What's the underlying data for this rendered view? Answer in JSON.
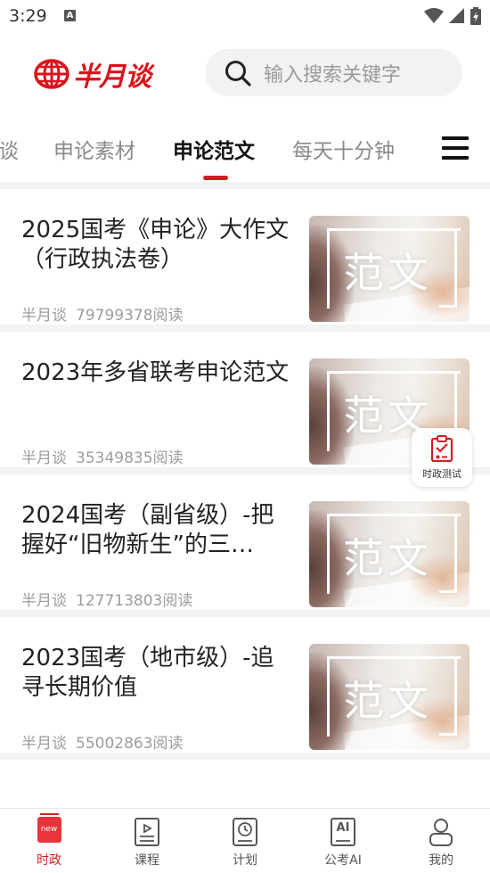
{
  "status_bar": {
    "time": "3:29",
    "notif_letter": "A"
  },
  "header": {
    "logo_text": "半月谈",
    "search_placeholder": "输入搜索关键字"
  },
  "tabs": [
    {
      "label": "谈",
      "active": false
    },
    {
      "label": "申论素材",
      "active": false
    },
    {
      "label": "申论范文",
      "active": true
    },
    {
      "label": "每天十分钟",
      "active": false
    }
  ],
  "articles": [
    {
      "title": "2025国考《申论》大作文（行政执法卷）",
      "source": "半月谈",
      "reads": "79799378阅读",
      "thumb_text": "范文"
    },
    {
      "title": "2023年多省联考申论范文",
      "source": "半月谈",
      "reads": "35349835阅读",
      "thumb_text": "范文"
    },
    {
      "title": "2024国考（副省级）-把握好“旧物新生”的三…",
      "source": "半月谈",
      "reads": "127713803阅读",
      "thumb_text": "范文"
    },
    {
      "title": "2023国考（地市级）-追寻长期价值",
      "source": "半月谈",
      "reads": "55002863阅读",
      "thumb_text": "范文"
    }
  ],
  "float_button": {
    "label": "时政测试"
  },
  "bottom_nav": [
    {
      "label": "时政",
      "icon": "news-icon",
      "badge": "new",
      "active": true
    },
    {
      "label": "课程",
      "icon": "course-icon",
      "active": false
    },
    {
      "label": "计划",
      "icon": "plan-icon",
      "active": false
    },
    {
      "label": "公考AI",
      "icon": "ai-icon",
      "icon_text": "AI",
      "active": false
    },
    {
      "label": "我的",
      "icon": "profile-icon",
      "active": false
    }
  ],
  "colors": {
    "accent": "#d01e23",
    "muted_text": "#9c9c9c",
    "tab_inactive": "#8a8a8a"
  }
}
